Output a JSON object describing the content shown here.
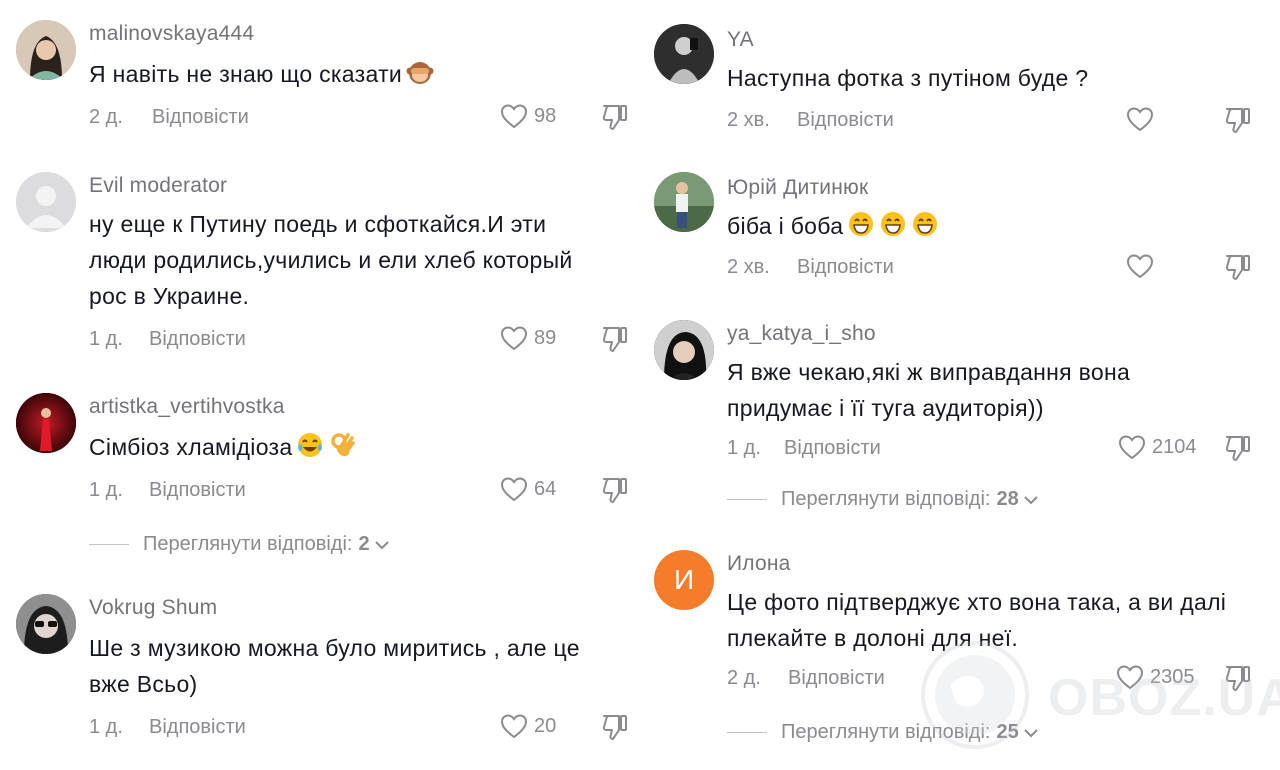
{
  "left_comments": [
    {
      "username": "malinovskaya444",
      "text": "Я навіть не знаю що сказати",
      "time": "2 д.",
      "reply_label": "Відповісти",
      "likes": "98"
    },
    {
      "username": "Evil moderator",
      "text": "ну еще к Путину поедь и сфоткайся.И эти\nлюди родились,учились и ели хлеб который\nрос в Украине.",
      "time": "1 д.",
      "reply_label": "Відповісти",
      "likes": "89"
    },
    {
      "username": "artistka_vertihvostka",
      "text": "Сімбіоз хламідіоза",
      "time": "1 д.",
      "reply_label": "Відповісти",
      "likes": "64",
      "view_replies_label": "Переглянути відповіді:",
      "view_replies_count": "2"
    },
    {
      "username": "Vokrug Shum",
      "text": "Ше з музикою можна було миритись , але це\nвже Всьо)",
      "time": "1 д.",
      "reply_label": "Відповісти",
      "likes": "20"
    }
  ],
  "right_comments": [
    {
      "username": "YA",
      "text": "Наступна фотка з путіном буде ?",
      "time": "2 хв.",
      "reply_label": "Відповісти"
    },
    {
      "username": "Юрій Дитинюк",
      "text": "біба і боба",
      "time": "2 хв.",
      "reply_label": "Відповісти"
    },
    {
      "username": "ya_katya_i_sho",
      "text": "Я вже чекаю,які ж виправдання вона\nпридумає і її туга аудиторія))",
      "time": "1 д.",
      "reply_label": "Відповісти",
      "likes": "2104",
      "view_replies_label": "Переглянути відповіді:",
      "view_replies_count": "28"
    },
    {
      "username": "Илона",
      "avatar_letter": "И",
      "text": "Це фото підтверджує хто вона така, а ви далі\nплекайте в долоні для неї.",
      "time": "2 д.",
      "reply_label": "Відповісти",
      "likes": "2305",
      "view_replies_label": "Переглянути відповіді:",
      "view_replies_count": "25"
    }
  ],
  "watermark": {
    "text": "OBOZ.UA"
  },
  "colors": {
    "text": "#161823",
    "muted": "#8a8b91",
    "avatar_orange": "#f57c2a"
  },
  "icons": [
    "heart-icon",
    "dislike-icon",
    "chevron-down-icon",
    "see-no-evil-monkey-emoji",
    "tears-of-joy-emoji",
    "ok-hand-emoji",
    "grinning-emoji"
  ]
}
